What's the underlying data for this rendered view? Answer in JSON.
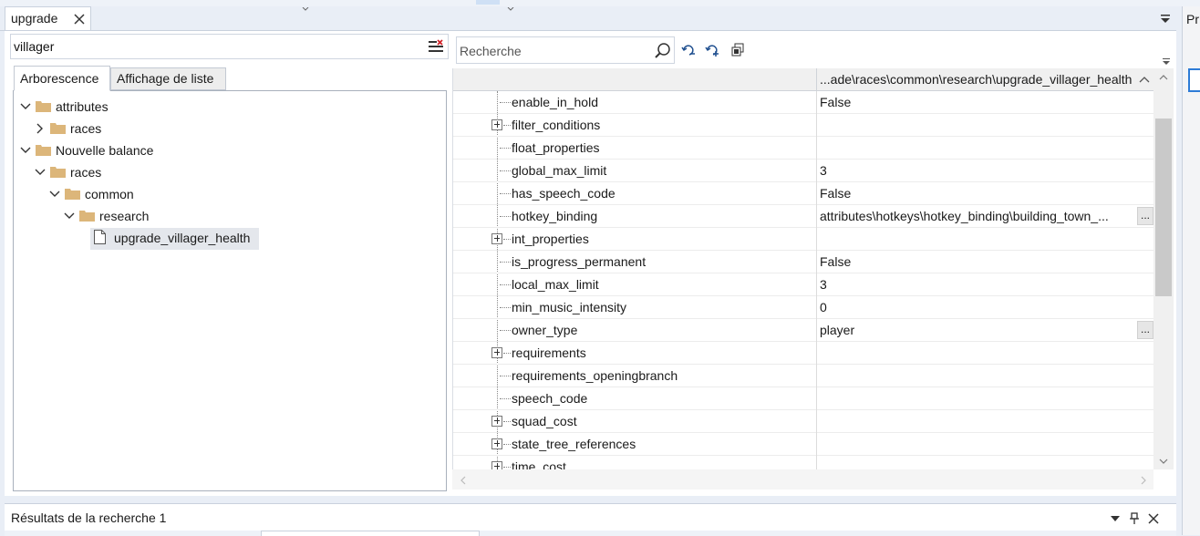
{
  "document_tab": {
    "label": "upgrade"
  },
  "right_dock": {
    "label": "Pr"
  },
  "filter": {
    "value": "villager"
  },
  "tree_tabs": {
    "tree": "Arborescence",
    "list": "Affichage de liste"
  },
  "tree": {
    "items": [
      {
        "label": "attributes",
        "expanded": true,
        "type": "folder"
      },
      {
        "label": "races",
        "expanded": false,
        "type": "folder"
      },
      {
        "label": "Nouvelle balance",
        "expanded": true,
        "type": "folder"
      },
      {
        "label": "races",
        "expanded": true,
        "type": "folder"
      },
      {
        "label": "common",
        "expanded": true,
        "type": "folder"
      },
      {
        "label": "research",
        "expanded": true,
        "type": "folder"
      },
      {
        "label": "upgrade_villager_health",
        "type": "file",
        "selected": true
      }
    ]
  },
  "search": {
    "placeholder": "Recherche"
  },
  "grid": {
    "header_path": "...ade\\races\\common\\research\\upgrade_villager_health",
    "rows": [
      {
        "name": "enable_in_hold",
        "value": "False"
      },
      {
        "name": "filter_conditions",
        "value": "",
        "expandable": true
      },
      {
        "name": "float_properties",
        "value": ""
      },
      {
        "name": "global_max_limit",
        "value": "3"
      },
      {
        "name": "has_speech_code",
        "value": "False"
      },
      {
        "name": "hotkey_binding",
        "value": "attributes\\hotkeys\\hotkey_binding\\building_town_...",
        "ellipsis": "..."
      },
      {
        "name": "int_properties",
        "value": "",
        "expandable": true
      },
      {
        "name": "is_progress_permanent",
        "value": "False"
      },
      {
        "name": "local_max_limit",
        "value": "3"
      },
      {
        "name": "min_music_intensity",
        "value": "0"
      },
      {
        "name": "owner_type",
        "value": "player",
        "ellipsis": "..."
      },
      {
        "name": "requirements",
        "value": "",
        "expandable": true
      },
      {
        "name": "requirements_openingbranch",
        "value": ""
      },
      {
        "name": "speech_code",
        "value": ""
      },
      {
        "name": "squad_cost",
        "value": "",
        "expandable": true
      },
      {
        "name": "state_tree_references",
        "value": "",
        "expandable": true
      },
      {
        "name": "time_cost",
        "value": "",
        "expandable": true
      }
    ]
  },
  "bottom_panel": {
    "title": "Résultats de la recherche 1"
  },
  "icons": {
    "clear_filter": "clear-filter-icon",
    "search": "search-icon",
    "collapse": "collapse-all-icon",
    "expand": "expand-all-icon",
    "copy": "copy-icon",
    "menu": "menu-icon",
    "pin": "pin-icon",
    "close": "close-icon"
  },
  "colors": {
    "accent": "#2d7bd6",
    "folder": "#dcb67a",
    "selected_row": "#e4e7ec"
  }
}
